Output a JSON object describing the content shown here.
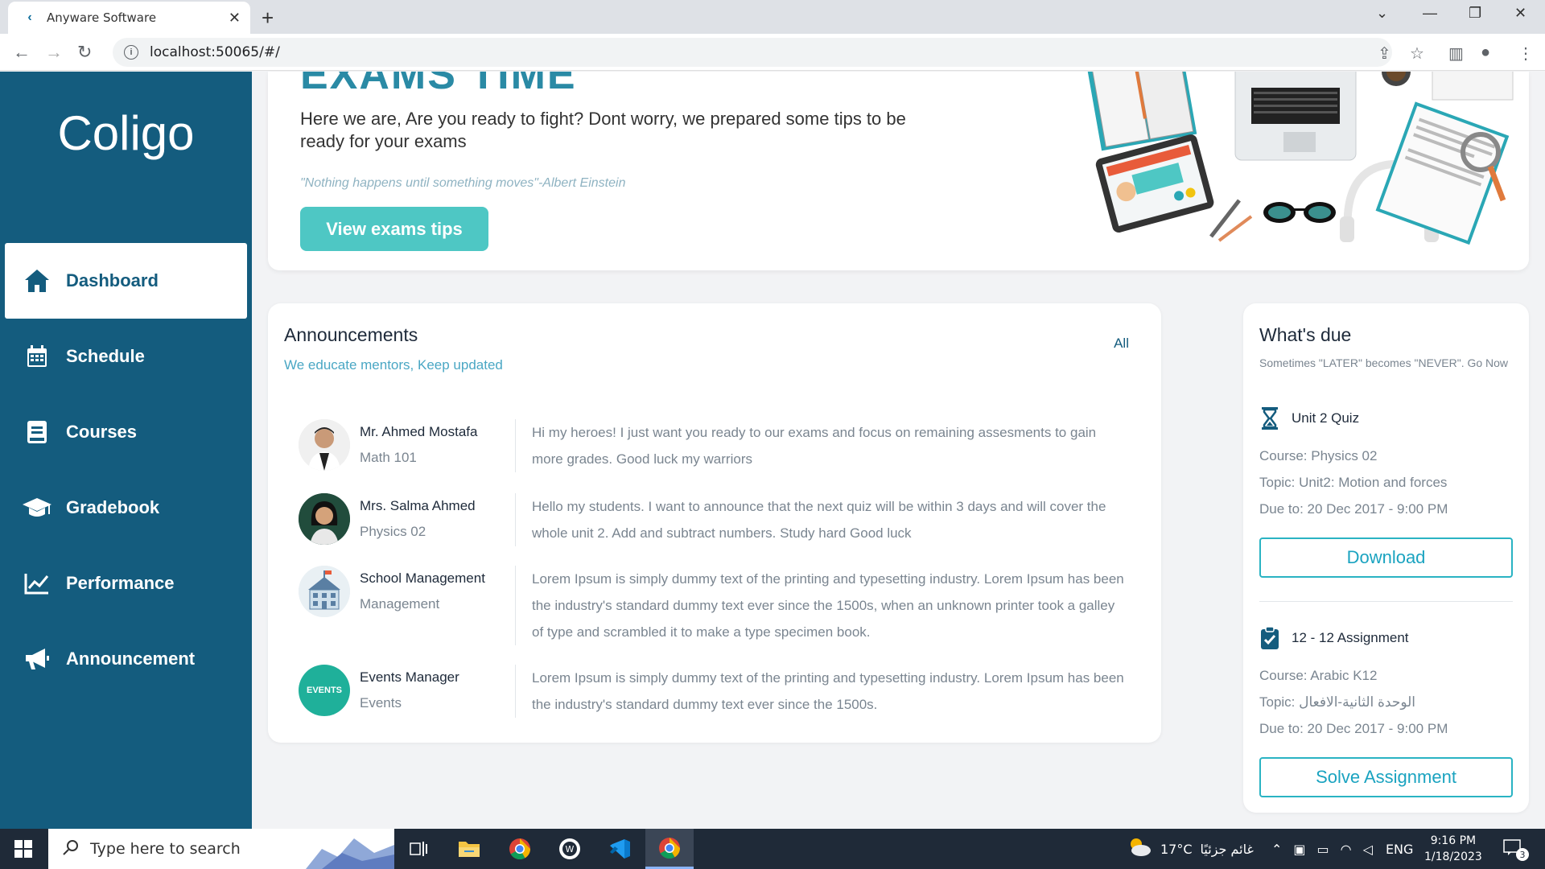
{
  "browser": {
    "tab_title": "Anyware Software",
    "url": "localhost:50065/#/"
  },
  "sidebar": {
    "logo": "Coligo",
    "items": [
      {
        "label": "Dashboard",
        "icon": "home-icon",
        "active": true
      },
      {
        "label": "Schedule",
        "icon": "calendar-icon",
        "active": false
      },
      {
        "label": "Courses",
        "icon": "book-icon",
        "active": false
      },
      {
        "label": "Gradebook",
        "icon": "graduation-cap-icon",
        "active": false
      },
      {
        "label": "Performance",
        "icon": "line-chart-icon",
        "active": false
      },
      {
        "label": "Announcement",
        "icon": "megaphone-icon",
        "active": false
      }
    ]
  },
  "hero": {
    "title": "EXAMS TIME",
    "text": "Here we are, Are you ready to fight? Dont worry, we prepared some tips to be ready for your exams",
    "quote": "\"Nothing happens until something moves\"-Albert Einstein",
    "button": "View exams tips"
  },
  "announcements": {
    "title": "Announcements",
    "subtitle": "We educate mentors, Keep updated",
    "all_link": "All",
    "items": [
      {
        "name": "Mr. Ahmed Mostafa",
        "role": "Math 101",
        "message": "Hi my heroes! I just want you ready to our exams and focus on remaining assesments to gain more grades. Good luck my warriors"
      },
      {
        "name": "Mrs. Salma Ahmed",
        "role": "Physics 02",
        "message": "Hello my students. I want to announce that the next quiz will be within 3 days and will cover the whole unit 2. Add and subtract numbers. Study hard Good luck"
      },
      {
        "name": "School Management",
        "role": "Management",
        "message": "Lorem Ipsum is simply dummy text of the printing and typesetting industry. Lorem Ipsum has been the industry's standard dummy text ever since the 1500s, when an unknown printer took a galley of type and scrambled it to make a type specimen book."
      },
      {
        "name": "Events Manager",
        "role": "Events",
        "message": "Lorem Ipsum is simply dummy text of the printing and typesetting industry. Lorem Ipsum has been the industry's standard dummy text ever since the 1500s.",
        "avatar_text": "EVENTS"
      }
    ]
  },
  "whats_due": {
    "title": "What's due",
    "subtitle": "Sometimes \"LATER\" becomes \"NEVER\". Go Now",
    "items": [
      {
        "name": "Unit 2 Quiz",
        "icon": "hourglass-icon",
        "course": "Course: Physics 02",
        "topic": "Topic: Unit2: Motion and forces",
        "due": "Due to: 20 Dec 2017 - 9:00 PM",
        "button": "Download"
      },
      {
        "name": "12 - 12 Assignment",
        "icon": "clipboard-check-icon",
        "course": "Course: Arabic K12",
        "topic": "Topic: الوحدة الثانية-الافعال",
        "due": "Due to: 20 Dec 2017 - 9:00 PM",
        "button": "Solve Assignment"
      }
    ]
  },
  "taskbar": {
    "search_placeholder": "Type here to search",
    "weather": "17°C",
    "weather_desc": "غائم جزئيًا",
    "lang": "ENG",
    "time": "9:16 PM",
    "date": "1/18/2023",
    "notifications": "3"
  },
  "colors": {
    "sidebar": "#145c7e",
    "accent": "#4ec7c4",
    "button_border": "#2ab3c3"
  }
}
